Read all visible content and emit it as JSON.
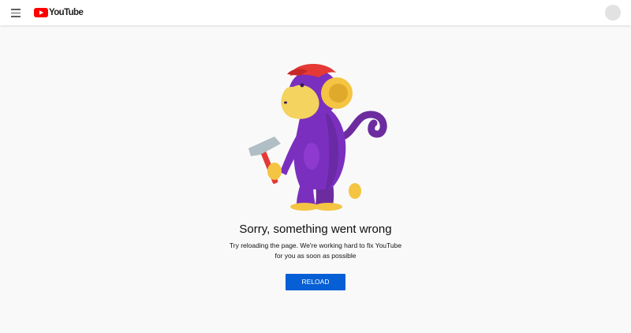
{
  "header": {
    "menu_icon": "hamburger-menu-icon",
    "logo_text": "YouTube",
    "logo_icon": "youtube-play-icon",
    "avatar_icon": "account-avatar-icon",
    "brand_color": "#ff0000"
  },
  "error": {
    "illustration_icon": "monkey-with-hammer-icon",
    "title": "Sorry, something went wrong",
    "message_line1": "Try reloading the page. We're working hard to fix YouTube",
    "message_line2": "for you as soon as possible",
    "reload_label": "RELOAD",
    "reload_color": "#065fd4"
  }
}
